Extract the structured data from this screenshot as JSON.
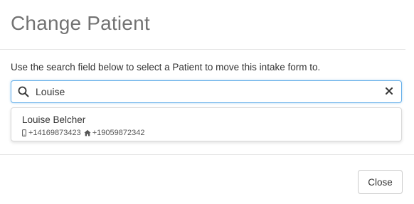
{
  "modal": {
    "title": "Change Patient",
    "instructions": "Use the search field below to select a Patient to move this intake form to."
  },
  "search": {
    "value": "Louise",
    "search_icon": "search-icon",
    "clear_icon": "close-icon"
  },
  "results": [
    {
      "name": "Louise Belcher",
      "mobile_icon": "mobile-phone-icon",
      "mobile": "+14169873423",
      "home_icon": "home-icon",
      "home": "+19059872342"
    }
  ],
  "footer": {
    "close_label": "Close"
  },
  "colors": {
    "title": "#737373",
    "focus_border": "#66afe9",
    "divider": "#e5e5e5"
  }
}
